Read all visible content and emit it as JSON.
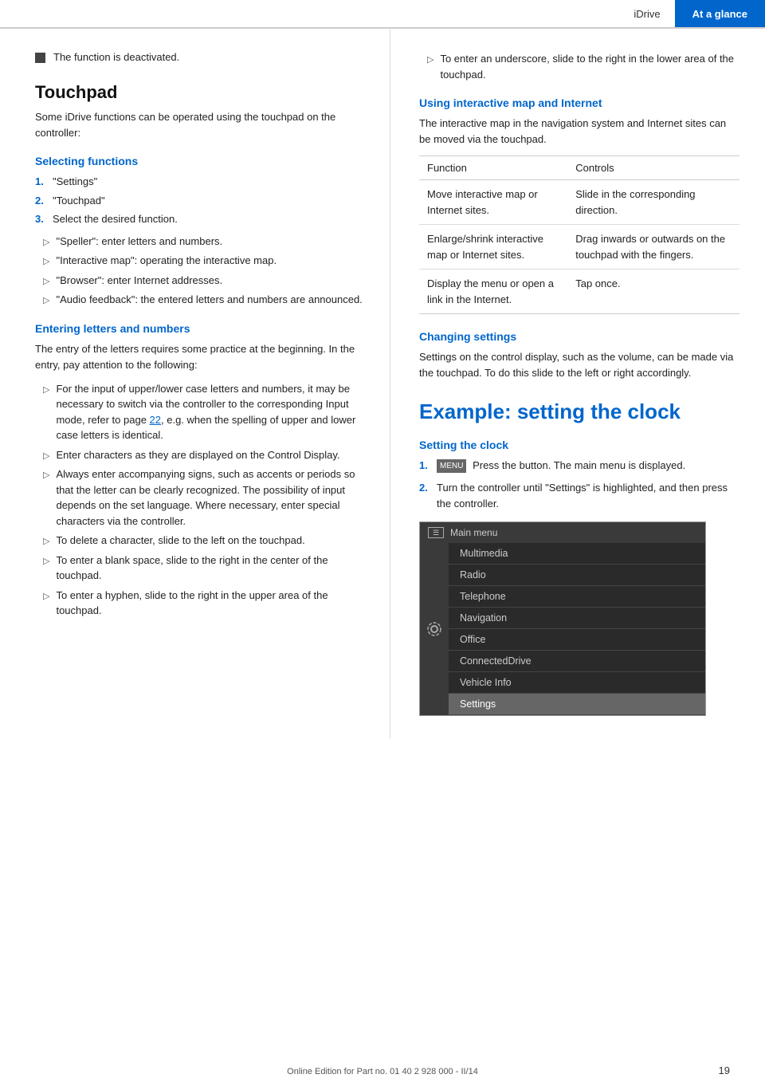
{
  "header": {
    "idrive_label": "iDrive",
    "ataglance_label": "At a glance"
  },
  "left": {
    "deactivated_text": "The function is deactivated.",
    "touchpad_title": "Touchpad",
    "touchpad_intro": "Some iDrive functions can be operated using the touchpad on the controller:",
    "selecting_functions": {
      "heading": "Selecting functions",
      "steps": [
        {
          "num": "1.",
          "text": "\"Settings\""
        },
        {
          "num": "2.",
          "text": "\"Touchpad\""
        },
        {
          "num": "3.",
          "text": "Select the desired function."
        }
      ],
      "sub_items": [
        "\"Speller\": enter letters and numbers.",
        "\"Interactive map\": operating the interactive map.",
        "\"Browser\": enter Internet addresses.",
        "\"Audio feedback\": the entered letters and numbers are announced."
      ]
    },
    "entering_letters": {
      "heading": "Entering letters and numbers",
      "intro": "The entry of the letters requires some practice at the beginning. In the entry, pay attention to the following:",
      "items": [
        "For the input of upper/lower case letters and numbers, it may be necessary to switch via the controller to the corresponding Input mode, refer to page 22, e.g. when the spelling of upper and lower case letters is identical.",
        "Enter characters as they are displayed on the Control Display.",
        "Always enter accompanying signs, such as accents or periods so that the letter can be clearly recognized. The possibility of input depends on the set language. Where necessary, enter special characters via the controller.",
        "To delete a character, slide to the left on the touchpad.",
        "To enter a blank space, slide to the right in the center of the touchpad.",
        "To enter a hyphen, slide to the right in the upper area of the touchpad."
      ]
    }
  },
  "right": {
    "underscore_note": "To enter an underscore, slide to the right in the lower area of the touchpad.",
    "interactive_map": {
      "heading": "Using interactive map and Internet",
      "intro": "The interactive map in the navigation system and Internet sites can be moved via the touchpad.",
      "table": {
        "col1": "Function",
        "col2": "Controls",
        "rows": [
          {
            "function": "Move interactive map or Internet sites.",
            "controls": "Slide in the corresponding direction."
          },
          {
            "function": "Enlarge/shrink interactive map or Internet sites.",
            "controls": "Drag inwards or outwards on the touchpad with the fingers."
          },
          {
            "function": "Display the menu or open a link in the Internet.",
            "controls": "Tap once."
          }
        ]
      }
    },
    "changing_settings": {
      "heading": "Changing settings",
      "text": "Settings on the control display, such as the volume, can be made via the touchpad. To do this slide to the left or right accordingly."
    },
    "example_title": "Example: setting the clock",
    "setting_clock": {
      "heading": "Setting the clock",
      "steps": [
        {
          "num": "1.",
          "badge": "MENU",
          "text": "Press the button. The main menu is displayed."
        },
        {
          "num": "2.",
          "text": "Turn the controller until \"Settings\" is highlighted, and then press the controller."
        }
      ]
    },
    "menu": {
      "header": "Main menu",
      "items": [
        {
          "label": "Multimedia",
          "state": "normal"
        },
        {
          "label": "Radio",
          "state": "normal"
        },
        {
          "label": "Telephone",
          "state": "normal"
        },
        {
          "label": "Navigation",
          "state": "normal"
        },
        {
          "label": "Office",
          "state": "normal"
        },
        {
          "label": "ConnectedDrive",
          "state": "normal"
        },
        {
          "label": "Vehicle Info",
          "state": "normal"
        },
        {
          "label": "Settings",
          "state": "highlighted"
        }
      ]
    }
  },
  "footer": {
    "text": "Online Edition for Part no. 01 40 2 928 000 - II/14",
    "page_number": "19"
  }
}
